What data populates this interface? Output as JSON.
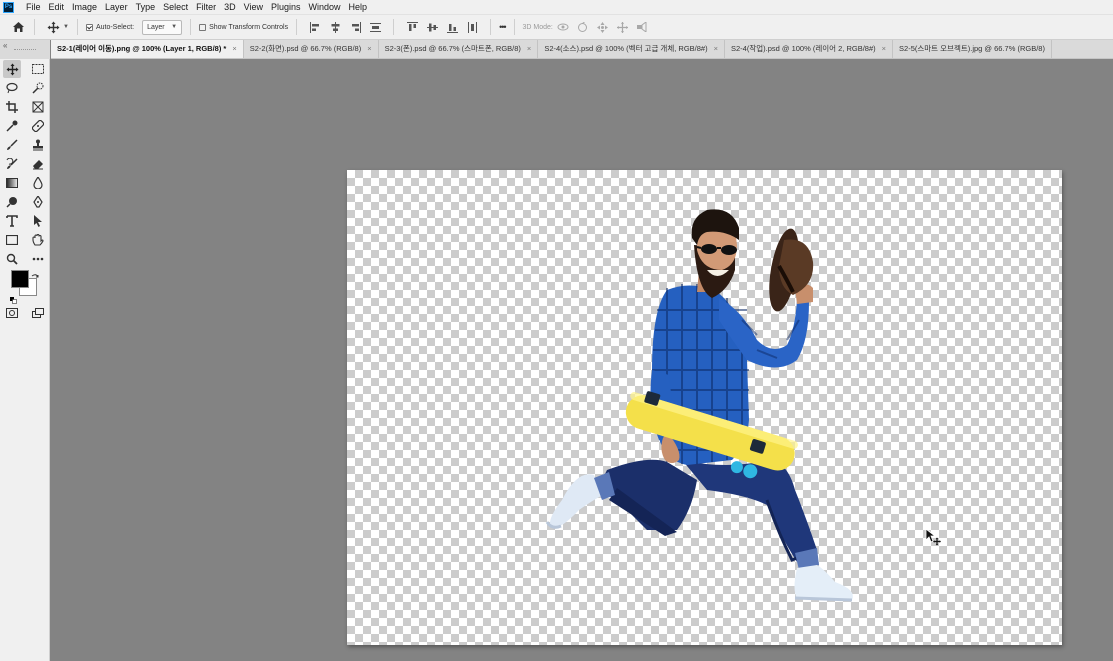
{
  "app": {
    "logo_text": "Ps"
  },
  "menu": [
    "File",
    "Edit",
    "Image",
    "Layer",
    "Type",
    "Select",
    "Filter",
    "3D",
    "View",
    "Plugins",
    "Window",
    "Help"
  ],
  "options": {
    "auto_select_label": "Auto-Select:",
    "auto_select_checked": true,
    "layer_select_value": "Layer",
    "show_transform_label": "Show Transform Controls",
    "show_transform_checked": false,
    "mode_3d_label": "3D Mode:",
    "more_label": "•••"
  },
  "panel_collapse": "«",
  "tabs": [
    {
      "label": "S2-1(레이어 이동).png @ 100% (Layer 1, RGB/8) *",
      "active": true
    },
    {
      "label": "S2-2(화면).psd @ 66.7% (RGB/8)",
      "active": false
    },
    {
      "label": "S2-3(폰).psd @ 66.7% (스마트폰, RGB/8)",
      "active": false
    },
    {
      "label": "S2-4(소스).psd @ 100% (벡터 고급 개체, RGB/8#)",
      "active": false
    },
    {
      "label": "S2-4(작업).psd @ 100% (레이어 2, RGB/8#)",
      "active": false
    },
    {
      "label": "S2-5(스마트 오브젝트).jpg @ 66.7% (RGB/8)",
      "active": false
    }
  ],
  "tab_close": "×",
  "tools": [
    [
      "move-tool-icon",
      "marquee-tool-icon"
    ],
    [
      "lasso-tool-icon",
      "quick-select-tool-icon"
    ],
    [
      "crop-tool-icon",
      "frame-tool-icon"
    ],
    [
      "eyedropper-tool-icon",
      "healing-brush-tool-icon"
    ],
    [
      "brush-tool-icon",
      "clone-stamp-tool-icon"
    ],
    [
      "history-brush-tool-icon",
      "eraser-tool-icon"
    ],
    [
      "gradient-tool-icon",
      "blur-tool-icon"
    ],
    [
      "dodge-tool-icon",
      "pen-tool-icon"
    ],
    [
      "type-tool-icon",
      "path-select-tool-icon"
    ],
    [
      "rectangle-tool-icon",
      "hand-tool-icon"
    ],
    [
      "zoom-tool-icon",
      "more-tools-icon"
    ]
  ],
  "colors": {
    "foreground": "#000000",
    "background": "#ffffff"
  }
}
